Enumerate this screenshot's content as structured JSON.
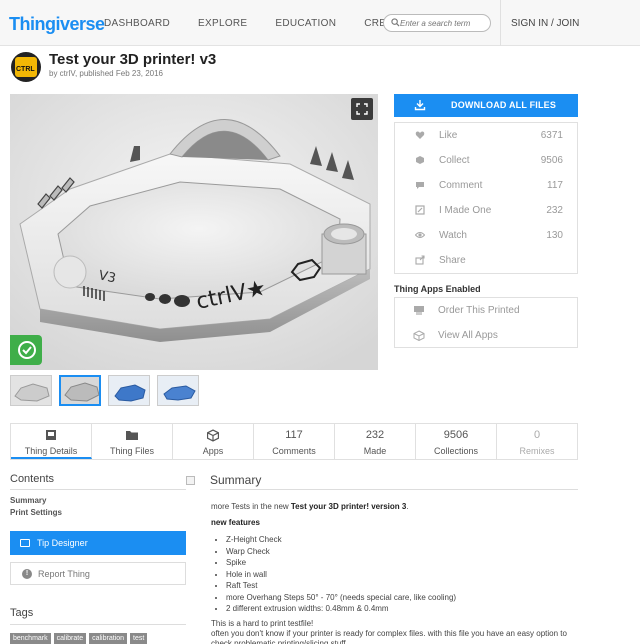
{
  "nav": {
    "logo": "Thingiverse",
    "links": [
      "DASHBOARD",
      "EXPLORE",
      "EDUCATION",
      "CREATE"
    ],
    "search_placeholder": "Enter a search term",
    "signin": "SIGN IN / JOIN"
  },
  "thing": {
    "title": "Test your 3D printer! v3",
    "byline": "by ctrlV, published Feb 23, 2016",
    "avatar_text": "CTRL"
  },
  "actions": {
    "download": "DOWNLOAD ALL FILES",
    "stats": [
      {
        "icon": "heart-icon",
        "label": "Like",
        "value": "6371"
      },
      {
        "icon": "collect-icon",
        "label": "Collect",
        "value": "9506"
      },
      {
        "icon": "comment-icon",
        "label": "Comment",
        "value": "117"
      },
      {
        "icon": "made-icon",
        "label": "I Made One",
        "value": "232"
      },
      {
        "icon": "eye-icon",
        "label": "Watch",
        "value": "130"
      },
      {
        "icon": "share-icon",
        "label": "Share",
        "value": ""
      }
    ],
    "apps_heading": "Thing Apps Enabled",
    "apps": [
      {
        "icon": "printer-icon",
        "label": "Order This Printed"
      },
      {
        "icon": "cube-icon",
        "label": "View All Apps"
      }
    ]
  },
  "tabs": [
    {
      "top": "",
      "bottom": "Thing Details",
      "icon": "details-icon"
    },
    {
      "top": "",
      "bottom": "Thing Files",
      "icon": "folder-icon"
    },
    {
      "top": "",
      "bottom": "Apps",
      "icon": "cube-icon"
    },
    {
      "top": "117",
      "bottom": "Comments"
    },
    {
      "top": "232",
      "bottom": "Made"
    },
    {
      "top": "9506",
      "bottom": "Collections"
    },
    {
      "top": "0",
      "bottom": "Remixes"
    }
  ],
  "sidebar": {
    "contents_heading": "Contents",
    "contents_items": [
      "Summary",
      "Print Settings"
    ],
    "tip_designer": "Tip Designer",
    "report": "Report Thing",
    "tags_heading": "Tags",
    "tags": [
      "benchmark",
      "calibrate",
      "calibration",
      "test"
    ]
  },
  "summary": {
    "heading": "Summary",
    "intro_pre": "more Tests in the new ",
    "intro_bold": "Test your 3D printer! version 3",
    "intro_post": ".",
    "features_heading": "new features",
    "features": [
      "Z-Height Check",
      "Warp Check",
      "Spike",
      "Hole in wall",
      "Raft Test",
      "more Overhang Steps 50° - 70° (needs special care, like cooling)",
      "2 different extrusion widths: 0.48mm & 0.4mm"
    ],
    "outro1": "This is a hard to print testfile!",
    "outro2": "often you don't know if your printer is ready for complex files. with this file you have an easy option to check problematic printing/slicing stuff."
  },
  "colors": {
    "accent": "#1b8ef2",
    "badge": "#3fae49"
  }
}
